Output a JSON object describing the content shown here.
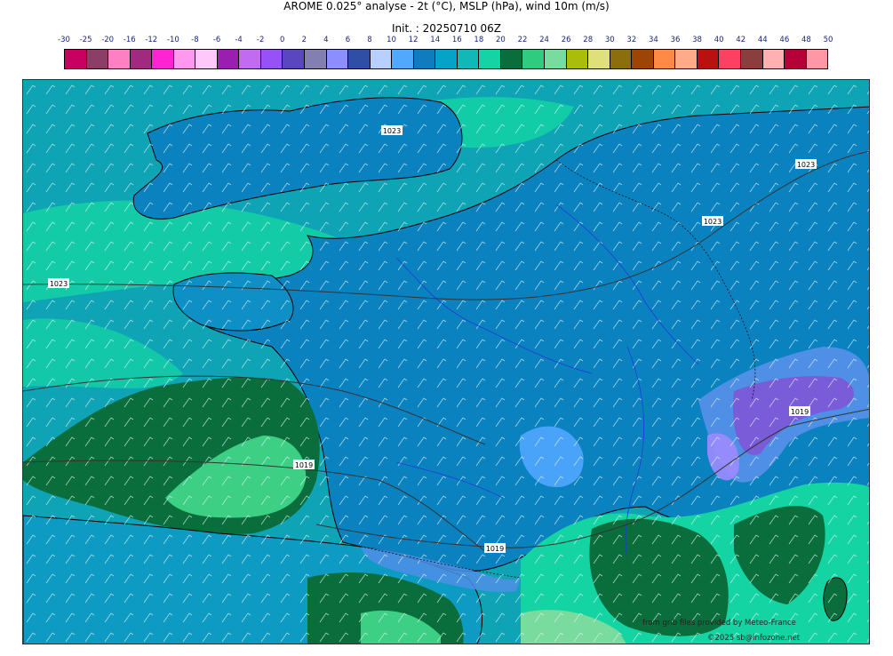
{
  "header": {
    "title": "AROME 0.025° analyse - 2t (°C), MSLP (hPa), wind 10m (m/s)",
    "init": "Init. : 20250710 06Z"
  },
  "colorbar": {
    "labels": [
      "-30",
      "-25",
      "-20",
      "-16",
      "-12",
      "-10",
      "-8",
      "-6",
      "-4",
      "-2",
      "0",
      "2",
      "4",
      "6",
      "8",
      "10",
      "12",
      "14",
      "16",
      "18",
      "20",
      "22",
      "24",
      "26",
      "28",
      "30",
      "32",
      "34",
      "36",
      "38",
      "40",
      "42",
      "44",
      "46",
      "48",
      "50"
    ],
    "colors": [
      "#c8005f",
      "#8c3f66",
      "#ff7fc3",
      "#a02a80",
      "#ff24d1",
      "#ff99ef",
      "#ffc8fa",
      "#9a1fb0",
      "#c16af2",
      "#9652f7",
      "#5a47bf",
      "#847fb3",
      "#8c8eff",
      "#2f4fa6",
      "#b8d0ff",
      "#52a8ff",
      "#0e7cbd",
      "#06a3c9",
      "#10b9b8",
      "#14d4a4",
      "#0a6e3c",
      "#2fcc7f",
      "#7adb9f",
      "#a9bd0a",
      "#e0e07a",
      "#8c6e0c",
      "#9e4505",
      "#ff8a45",
      "#ffaa88",
      "#b8110f",
      "#ff4060",
      "#8b3e3e",
      "#ffb0b0",
      "#b50038",
      "#ff97a5"
    ]
  },
  "map": {
    "isobar_labels": [
      "1023",
      "1023",
      "1023",
      "1023",
      "1019",
      "1019",
      "1019"
    ],
    "colors": {
      "sea_teal": "#0ea3b5",
      "land_blue": "#0b82c0",
      "warm_green": "#14d4a4",
      "dark_green": "#0a6e3c",
      "light_green": "#3dcf84",
      "alps_purple": "#7a5cd8",
      "coast": "#000000"
    }
  },
  "credits": {
    "source": "from grib files provided by Meteo-France",
    "copyright": "©2025 sb@infozone.net"
  }
}
